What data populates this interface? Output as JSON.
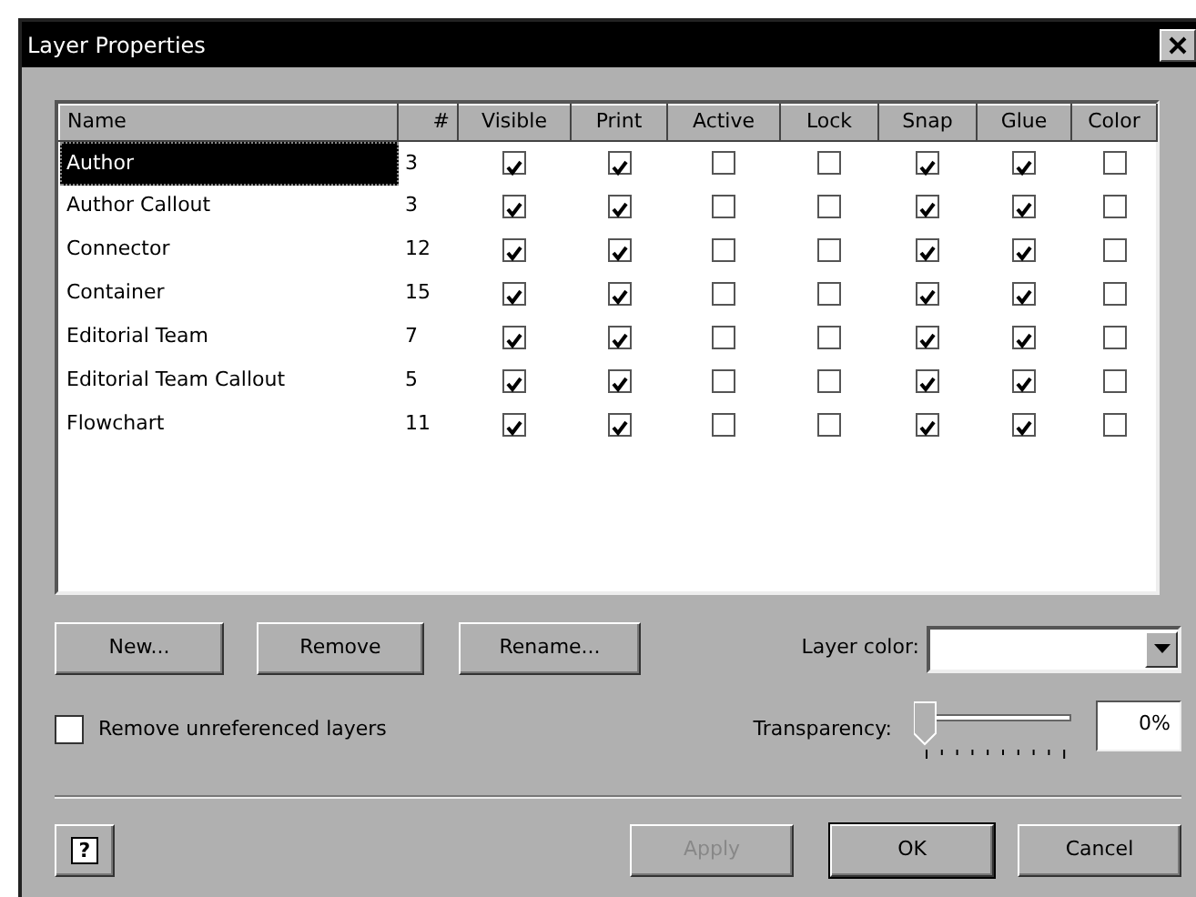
{
  "window": {
    "title": "Layer Properties"
  },
  "table": {
    "columns": [
      "Name",
      "#",
      "Visible",
      "Print",
      "Active",
      "Lock",
      "Snap",
      "Glue",
      "Color"
    ],
    "rows": [
      {
        "name": "Author",
        "count": "3",
        "selected": true,
        "visible": true,
        "print": true,
        "active": false,
        "lock": false,
        "snap": true,
        "glue": true,
        "color": false
      },
      {
        "name": "Author Callout",
        "count": "3",
        "selected": false,
        "visible": true,
        "print": true,
        "active": false,
        "lock": false,
        "snap": true,
        "glue": true,
        "color": false
      },
      {
        "name": "Connector",
        "count": "12",
        "selected": false,
        "visible": true,
        "print": true,
        "active": false,
        "lock": false,
        "snap": true,
        "glue": true,
        "color": false
      },
      {
        "name": "Container",
        "count": "15",
        "selected": false,
        "visible": true,
        "print": true,
        "active": false,
        "lock": false,
        "snap": true,
        "glue": true,
        "color": false
      },
      {
        "name": "Editorial Team",
        "count": "7",
        "selected": false,
        "visible": true,
        "print": true,
        "active": false,
        "lock": false,
        "snap": true,
        "glue": true,
        "color": false
      },
      {
        "name": "Editorial Team Callout",
        "count": "5",
        "selected": false,
        "visible": true,
        "print": true,
        "active": false,
        "lock": false,
        "snap": true,
        "glue": true,
        "color": false
      },
      {
        "name": "Flowchart",
        "count": "11",
        "selected": false,
        "visible": true,
        "print": true,
        "active": false,
        "lock": false,
        "snap": true,
        "glue": true,
        "color": false
      }
    ]
  },
  "layer_buttons": [
    "New...",
    "Remove",
    "Rename..."
  ],
  "layer_color": {
    "label": "Layer color:"
  },
  "remove_unreferenced": {
    "label": "Remove unreferenced layers",
    "checked": false
  },
  "transparency": {
    "label": "Transparency:",
    "level": 0,
    "value": "0%"
  },
  "help_button": "?",
  "footer_buttons": [
    {
      "label": "Apply",
      "disabled": true,
      "default": false
    },
    {
      "label": "OK",
      "disabled": false,
      "default": true
    },
    {
      "label": "Cancel",
      "disabled": false,
      "default": false
    }
  ]
}
